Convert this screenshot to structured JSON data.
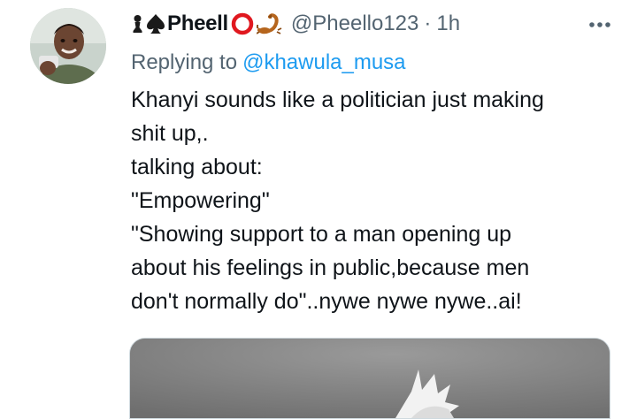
{
  "tweet": {
    "author": {
      "display_name": "Pheell",
      "emoji_prefix": [
        "pawn-icon",
        "spade-icon"
      ],
      "emoji_suffix": [
        "red-circle-icon",
        "scorpion-icon"
      ],
      "handle": "@Pheello123",
      "time": "1h"
    },
    "separator": "·",
    "replying_to_label": "Replying to",
    "replying_to_handle": "@khawula_musa",
    "text_lines": [
      "Khanyi sounds like a politician just making",
      "shit up,.",
      "talking about:",
      "\"Empowering\"",
      "\"Showing support to a man opening up",
      "about his feelings in public,because men",
      "don't normally do\"..nywe nywe nywe..ai!"
    ],
    "more_icon": "more-horizontal-icon",
    "media_icon": "photo-media"
  },
  "colors": {
    "text": "#0f1419",
    "secondary": "#536471",
    "link": "#1d9bf0",
    "red_circle": "#e0181f",
    "scorpion": "#b5651d"
  }
}
